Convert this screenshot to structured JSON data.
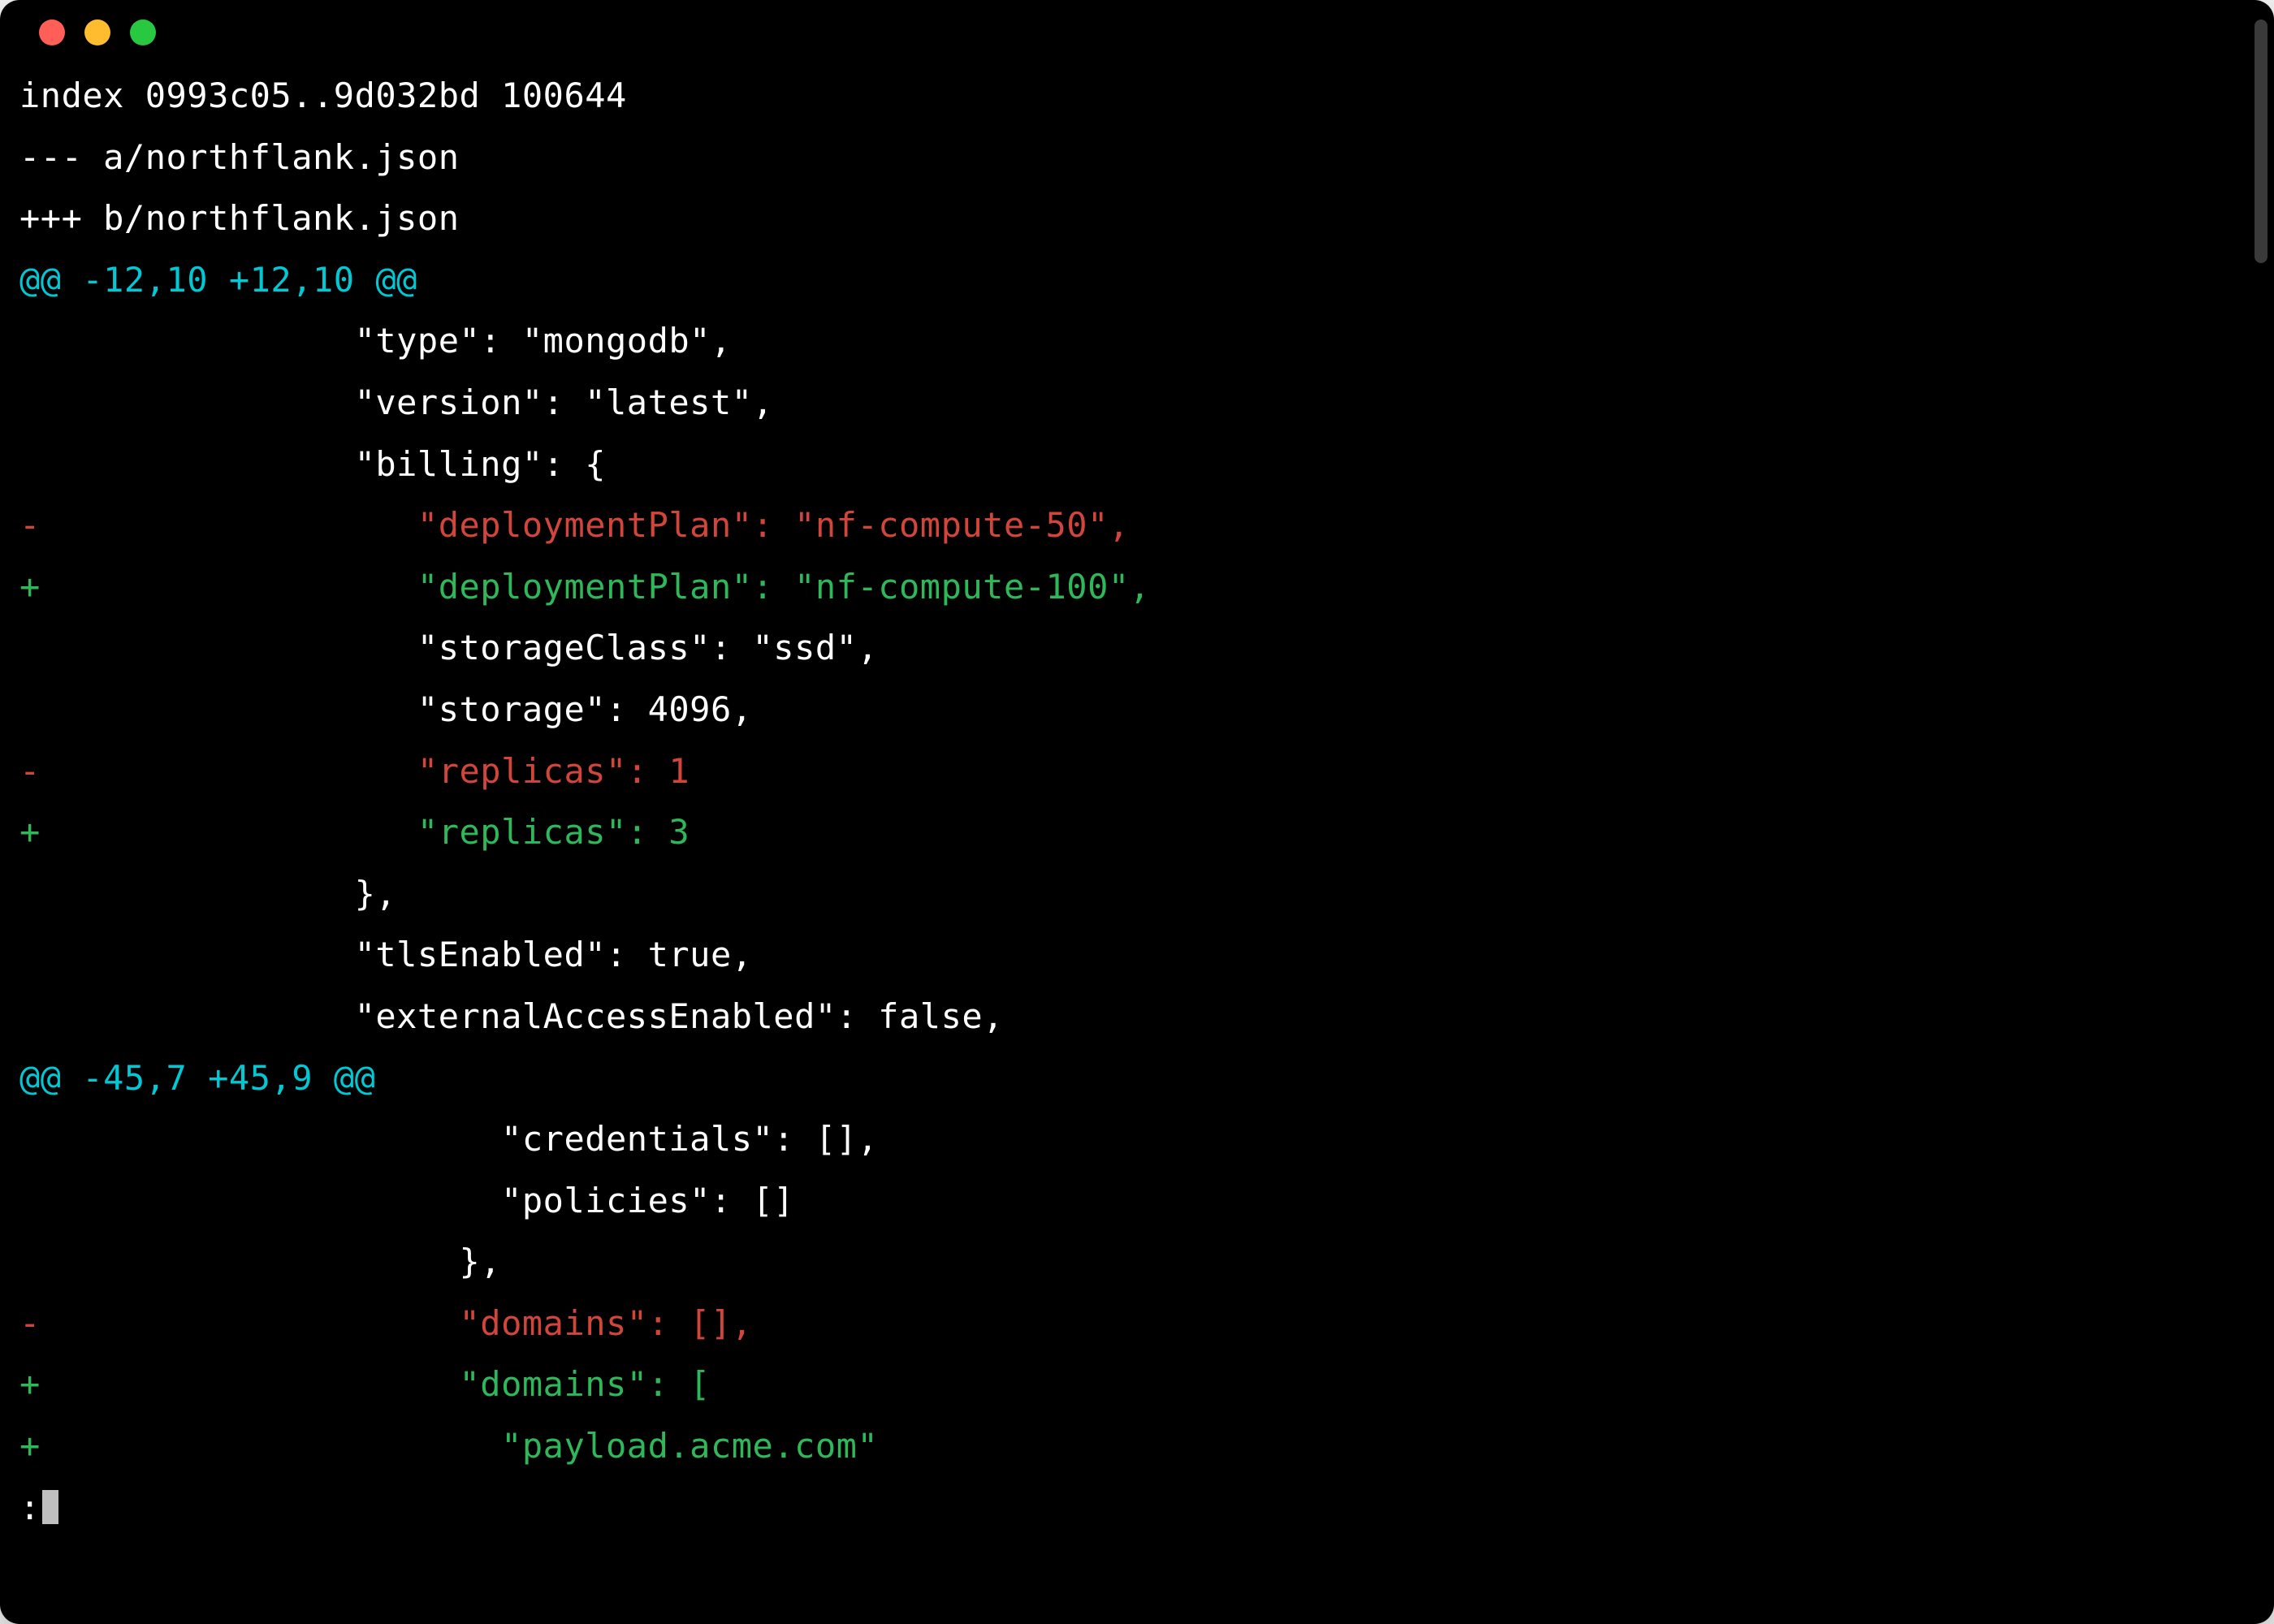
{
  "window": {
    "traffic_lights": [
      "red",
      "yellow",
      "green"
    ]
  },
  "diff": {
    "header": {
      "index_line": "index 0993c05..9d032bd 100644",
      "from_file": "--- a/northflank.json",
      "to_file": "+++ b/northflank.json"
    },
    "hunks": [
      {
        "marker": "@@ -12,10 +12,10 @@",
        "lines": [
          {
            "type": "context",
            "text": "                \"type\": \"mongodb\","
          },
          {
            "type": "context",
            "text": "                \"version\": \"latest\","
          },
          {
            "type": "context",
            "text": "                \"billing\": {"
          },
          {
            "type": "removed",
            "text": "-                  \"deploymentPlan\": \"nf-compute-50\","
          },
          {
            "type": "added",
            "text": "+                  \"deploymentPlan\": \"nf-compute-100\","
          },
          {
            "type": "context",
            "text": "                   \"storageClass\": \"ssd\","
          },
          {
            "type": "context",
            "text": "                   \"storage\": 4096,"
          },
          {
            "type": "removed",
            "text": "-                  \"replicas\": 1"
          },
          {
            "type": "added",
            "text": "+                  \"replicas\": 3"
          },
          {
            "type": "context",
            "text": "                },"
          },
          {
            "type": "context",
            "text": "                \"tlsEnabled\": true,"
          },
          {
            "type": "context",
            "text": "                \"externalAccessEnabled\": false,"
          }
        ]
      },
      {
        "marker": "@@ -45,7 +45,9 @@",
        "lines": [
          {
            "type": "context",
            "text": "                       \"credentials\": [],"
          },
          {
            "type": "context",
            "text": "                       \"policies\": []"
          },
          {
            "type": "context",
            "text": "                     },"
          },
          {
            "type": "removed",
            "text": "-                    \"domains\": [],"
          },
          {
            "type": "added",
            "text": "+                    \"domains\": ["
          },
          {
            "type": "added",
            "text": "+                      \"payload.acme.com\""
          }
        ]
      }
    ]
  },
  "prompt": {
    "symbol": ":"
  }
}
